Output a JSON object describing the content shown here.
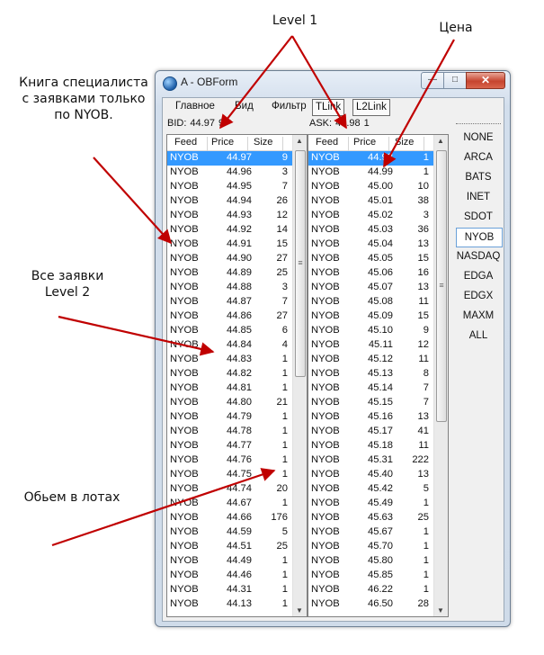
{
  "annotations": {
    "level1": "Level 1",
    "price": "Цена",
    "specialist_line1": "Книга специалиста",
    "specialist_line2": "с заявками только",
    "specialist_line3": "по NYOB.",
    "all_orders_line1": "Все заявки",
    "all_orders_line2": "Level 2",
    "volume": "Обьем в лотах"
  },
  "window": {
    "title": "A - OBForm",
    "close_glyph": "✕",
    "min_glyph": "—",
    "max_glyph": "□"
  },
  "menu": {
    "main": "Главное",
    "view": "Вид",
    "filter": "Фильтр",
    "tlink": "TLink",
    "l2link": "L2Link"
  },
  "bid": {
    "label": "BID:",
    "price": "44.97",
    "size": "9"
  },
  "ask": {
    "label": "ASK:",
    "price": "44.98",
    "size": "1"
  },
  "columns": {
    "feed": "Feed",
    "price": "Price",
    "size": "Size"
  },
  "bids": [
    {
      "feed": "NYOB",
      "price": "44.97",
      "size": "9"
    },
    {
      "feed": "NYOB",
      "price": "44.96",
      "size": "3"
    },
    {
      "feed": "NYOB",
      "price": "44.95",
      "size": "7"
    },
    {
      "feed": "NYOB",
      "price": "44.94",
      "size": "26"
    },
    {
      "feed": "NYOB",
      "price": "44.93",
      "size": "12"
    },
    {
      "feed": "NYOB",
      "price": "44.92",
      "size": "14"
    },
    {
      "feed": "NYOB",
      "price": "44.91",
      "size": "15"
    },
    {
      "feed": "NYOB",
      "price": "44.90",
      "size": "27"
    },
    {
      "feed": "NYOB",
      "price": "44.89",
      "size": "25"
    },
    {
      "feed": "NYOB",
      "price": "44.88",
      "size": "3"
    },
    {
      "feed": "NYOB",
      "price": "44.87",
      "size": "7"
    },
    {
      "feed": "NYOB",
      "price": "44.86",
      "size": "27"
    },
    {
      "feed": "NYOB",
      "price": "44.85",
      "size": "6"
    },
    {
      "feed": "NYOB",
      "price": "44.84",
      "size": "4"
    },
    {
      "feed": "NYOB",
      "price": "44.83",
      "size": "1"
    },
    {
      "feed": "NYOB",
      "price": "44.82",
      "size": "1"
    },
    {
      "feed": "NYOB",
      "price": "44.81",
      "size": "1"
    },
    {
      "feed": "NYOB",
      "price": "44.80",
      "size": "21"
    },
    {
      "feed": "NYOB",
      "price": "44.79",
      "size": "1"
    },
    {
      "feed": "NYOB",
      "price": "44.78",
      "size": "1"
    },
    {
      "feed": "NYOB",
      "price": "44.77",
      "size": "1"
    },
    {
      "feed": "NYOB",
      "price": "44.76",
      "size": "1"
    },
    {
      "feed": "NYOB",
      "price": "44.75",
      "size": "1"
    },
    {
      "feed": "NYOB",
      "price": "44.74",
      "size": "20"
    },
    {
      "feed": "NYOB",
      "price": "44.67",
      "size": "1"
    },
    {
      "feed": "NYOB",
      "price": "44.66",
      "size": "176"
    },
    {
      "feed": "NYOB",
      "price": "44.59",
      "size": "5"
    },
    {
      "feed": "NYOB",
      "price": "44.51",
      "size": "25"
    },
    {
      "feed": "NYOB",
      "price": "44.49",
      "size": "1"
    },
    {
      "feed": "NYOB",
      "price": "44.46",
      "size": "1"
    },
    {
      "feed": "NYOB",
      "price": "44.31",
      "size": "1"
    },
    {
      "feed": "NYOB",
      "price": "44.13",
      "size": "1"
    }
  ],
  "asks": [
    {
      "feed": "NYOB",
      "price": "44.98",
      "size": "1"
    },
    {
      "feed": "NYOB",
      "price": "44.99",
      "size": "1"
    },
    {
      "feed": "NYOB",
      "price": "45.00",
      "size": "10"
    },
    {
      "feed": "NYOB",
      "price": "45.01",
      "size": "38"
    },
    {
      "feed": "NYOB",
      "price": "45.02",
      "size": "3"
    },
    {
      "feed": "NYOB",
      "price": "45.03",
      "size": "36"
    },
    {
      "feed": "NYOB",
      "price": "45.04",
      "size": "13"
    },
    {
      "feed": "NYOB",
      "price": "45.05",
      "size": "15"
    },
    {
      "feed": "NYOB",
      "price": "45.06",
      "size": "16"
    },
    {
      "feed": "NYOB",
      "price": "45.07",
      "size": "13"
    },
    {
      "feed": "NYOB",
      "price": "45.08",
      "size": "11"
    },
    {
      "feed": "NYOB",
      "price": "45.09",
      "size": "15"
    },
    {
      "feed": "NYOB",
      "price": "45.10",
      "size": "9"
    },
    {
      "feed": "NYOB",
      "price": "45.11",
      "size": "12"
    },
    {
      "feed": "NYOB",
      "price": "45.12",
      "size": "11"
    },
    {
      "feed": "NYOB",
      "price": "45.13",
      "size": "8"
    },
    {
      "feed": "NYOB",
      "price": "45.14",
      "size": "7"
    },
    {
      "feed": "NYOB",
      "price": "45.15",
      "size": "7"
    },
    {
      "feed": "NYOB",
      "price": "45.16",
      "size": "13"
    },
    {
      "feed": "NYOB",
      "price": "45.17",
      "size": "41"
    },
    {
      "feed": "NYOB",
      "price": "45.18",
      "size": "11"
    },
    {
      "feed": "NYOB",
      "price": "45.31",
      "size": "222"
    },
    {
      "feed": "NYOB",
      "price": "45.40",
      "size": "13"
    },
    {
      "feed": "NYOB",
      "price": "45.42",
      "size": "5"
    },
    {
      "feed": "NYOB",
      "price": "45.49",
      "size": "1"
    },
    {
      "feed": "NYOB",
      "price": "45.63",
      "size": "25"
    },
    {
      "feed": "NYOB",
      "price": "45.67",
      "size": "1"
    },
    {
      "feed": "NYOB",
      "price": "45.70",
      "size": "1"
    },
    {
      "feed": "NYOB",
      "price": "45.80",
      "size": "1"
    },
    {
      "feed": "NYOB",
      "price": "45.85",
      "size": "1"
    },
    {
      "feed": "NYOB",
      "price": "46.22",
      "size": "1"
    },
    {
      "feed": "NYOB",
      "price": "46.50",
      "size": "28"
    }
  ],
  "exchanges": [
    "NONE",
    "ARCA",
    "BATS",
    "INET",
    "SDOT",
    "NYOB",
    "NASDAQ",
    "EDGA",
    "EDGX",
    "MAXM",
    "ALL"
  ],
  "active_exchange": "NYOB",
  "colors": {
    "selection": "#3399ff",
    "arrow": "#c00000"
  }
}
